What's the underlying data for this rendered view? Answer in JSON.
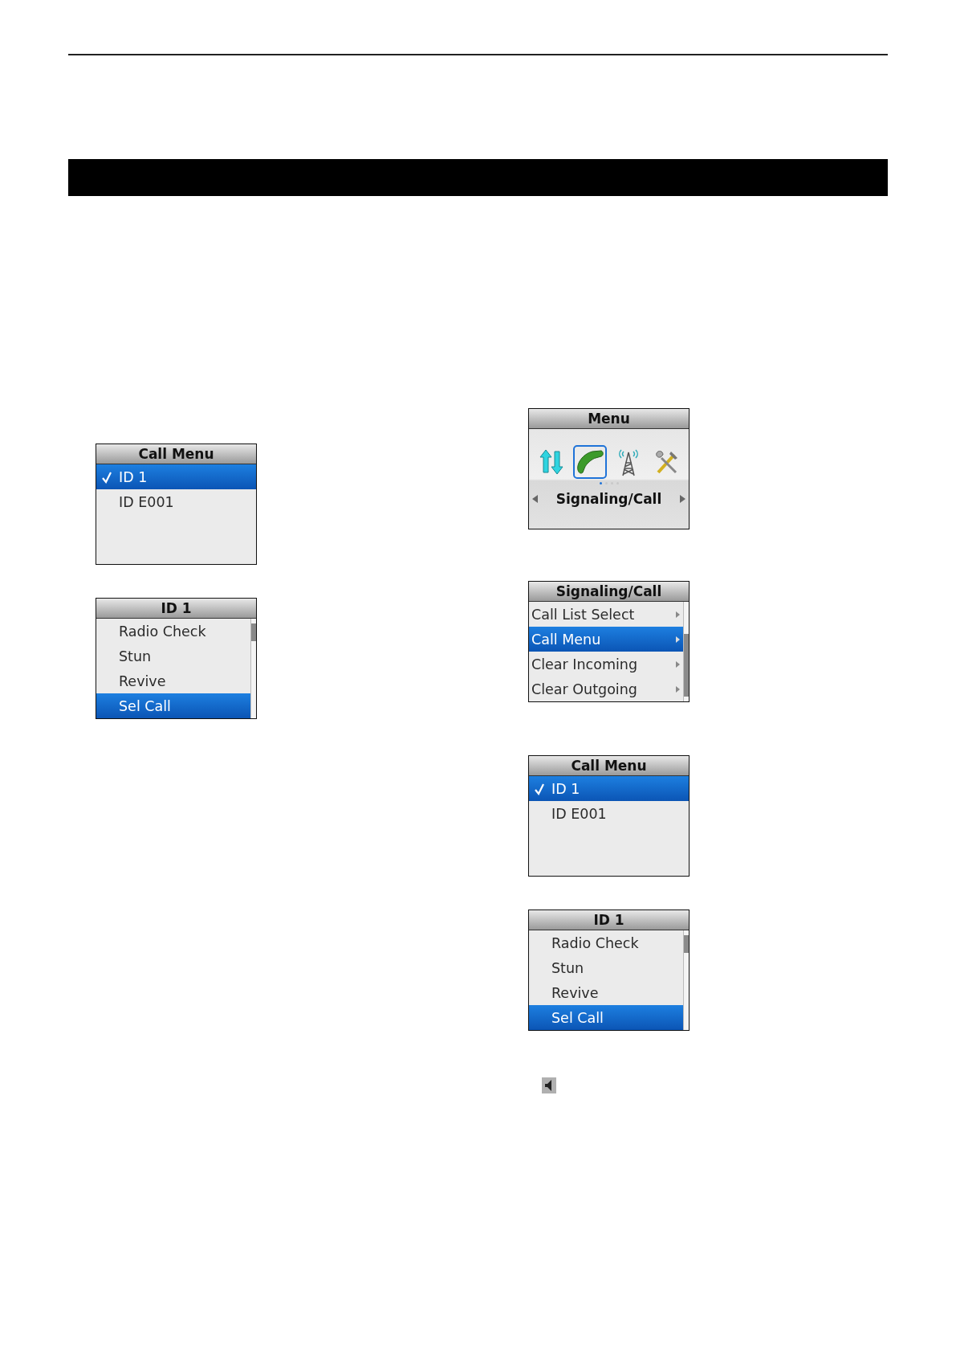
{
  "columns": [
    {
      "screens": [
        {
          "kind": "check_list",
          "title": "Call Menu",
          "scrollable": false,
          "items": [
            {
              "label": "ID 1",
              "selected": true,
              "checked": true
            },
            {
              "label": "ID E001",
              "selected": false,
              "checked": false
            }
          ]
        },
        {
          "kind": "check_list",
          "title": "ID 1",
          "scrollable": true,
          "items": [
            {
              "label": "Radio Check",
              "selected": false,
              "checked": false
            },
            {
              "label": "Stun",
              "selected": false,
              "checked": false
            },
            {
              "label": "Revive",
              "selected": false,
              "checked": false
            },
            {
              "label": "Sel Call",
              "selected": true,
              "checked": false
            }
          ]
        }
      ]
    },
    {
      "screens": [
        {
          "kind": "icon_menu",
          "title": "Menu",
          "icons": [
            {
              "kind": "arrows",
              "selected": false
            },
            {
              "kind": "phone",
              "selected": true
            },
            {
              "kind": "tower",
              "selected": false
            },
            {
              "kind": "tools",
              "selected": false
            }
          ],
          "pages": [
            {
              "selected": true
            },
            {
              "selected": false
            },
            {
              "selected": false
            },
            {
              "selected": false
            }
          ],
          "label": "Signaling/Call"
        },
        {
          "kind": "submenu_list",
          "title": "Signaling/Call",
          "scrollable": true,
          "items": [
            {
              "label": "Call List Select",
              "selected": false
            },
            {
              "label": "Call Menu",
              "selected": true
            },
            {
              "label": "Clear Incoming",
              "selected": false
            },
            {
              "label": "Clear Outgoing",
              "selected": false
            }
          ]
        },
        {
          "kind": "check_list",
          "title": "Call Menu",
          "scrollable": false,
          "items": [
            {
              "label": "ID 1",
              "selected": true,
              "checked": true
            },
            {
              "label": "ID E001",
              "selected": false,
              "checked": false
            }
          ]
        },
        {
          "kind": "check_list",
          "title": "ID 1",
          "scrollable": true,
          "items": [
            {
              "label": "Radio Check",
              "selected": false,
              "checked": false
            },
            {
              "label": "Stun",
              "selected": false,
              "checked": false
            },
            {
              "label": "Revive",
              "selected": false,
              "checked": false
            },
            {
              "label": "Sel Call",
              "selected": true,
              "checked": false
            }
          ]
        }
      ],
      "speaker_key": true
    }
  ]
}
